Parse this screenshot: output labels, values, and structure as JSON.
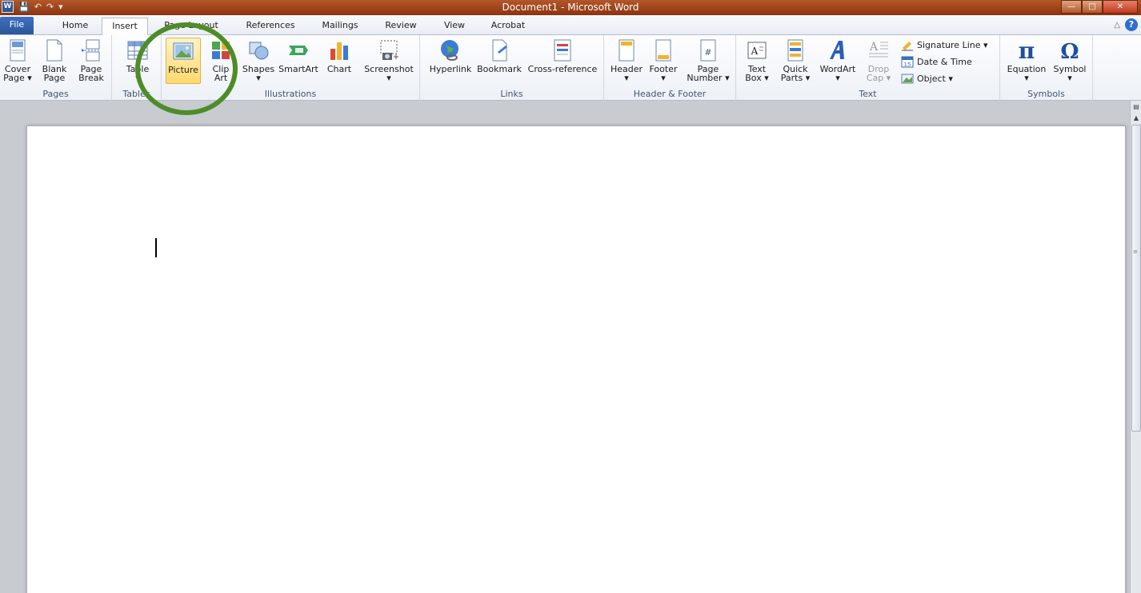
{
  "window": {
    "title": "Document1  -  Microsoft Word",
    "app_logo": "W",
    "controls": {
      "minimize": "—",
      "maximize": "□",
      "close": "✕"
    }
  },
  "tabs": [
    {
      "label": "File"
    },
    {
      "label": "Home"
    },
    {
      "label": "Insert",
      "active": true
    },
    {
      "label": "Page Layout"
    },
    {
      "label": "References"
    },
    {
      "label": "Mailings"
    },
    {
      "label": "Review"
    },
    {
      "label": "View"
    },
    {
      "label": "Acrobat"
    }
  ],
  "ribbon": {
    "pages": {
      "label": "Pages",
      "cover": [
        "Cover",
        "Page ▾"
      ],
      "blank": [
        "Blank",
        "Page"
      ],
      "break": [
        "Page",
        "Break"
      ]
    },
    "tables": {
      "label": "Tables",
      "table": [
        "Table",
        "▾"
      ]
    },
    "illustrations": {
      "label": "Illustrations",
      "picture": "Picture",
      "clipart": [
        "Clip",
        "Art"
      ],
      "shapes": [
        "Shapes",
        "▾"
      ],
      "smartart": "SmartArt",
      "chart": "Chart",
      "screenshot": [
        "Screenshot",
        "▾"
      ]
    },
    "links": {
      "label": "Links",
      "hyperlink": "Hyperlink",
      "bookmark": "Bookmark",
      "crossref": "Cross-reference"
    },
    "headerfooter": {
      "label": "Header & Footer",
      "header": [
        "Header",
        "▾"
      ],
      "footer": [
        "Footer",
        "▾"
      ],
      "pagenumber": [
        "Page",
        "Number ▾"
      ]
    },
    "text": {
      "label": "Text",
      "textbox": [
        "Text",
        "Box ▾"
      ],
      "quickparts": [
        "Quick",
        "Parts ▾"
      ],
      "wordart": [
        "WordArt",
        "▾"
      ],
      "dropcap": [
        "Drop",
        "Cap ▾"
      ],
      "signature": "Signature Line ▾",
      "datetime": "Date & Time",
      "object": "Object ▾"
    },
    "symbols": {
      "label": "Symbols",
      "equation": [
        "Equation",
        "▾"
      ],
      "symbol": [
        "Symbol",
        "▾"
      ]
    }
  },
  "colors": {
    "titlebar": "#8a3410",
    "file_tab": "#2b5797",
    "highlight": "#ffd96c",
    "annotation": "#4e8c28"
  }
}
